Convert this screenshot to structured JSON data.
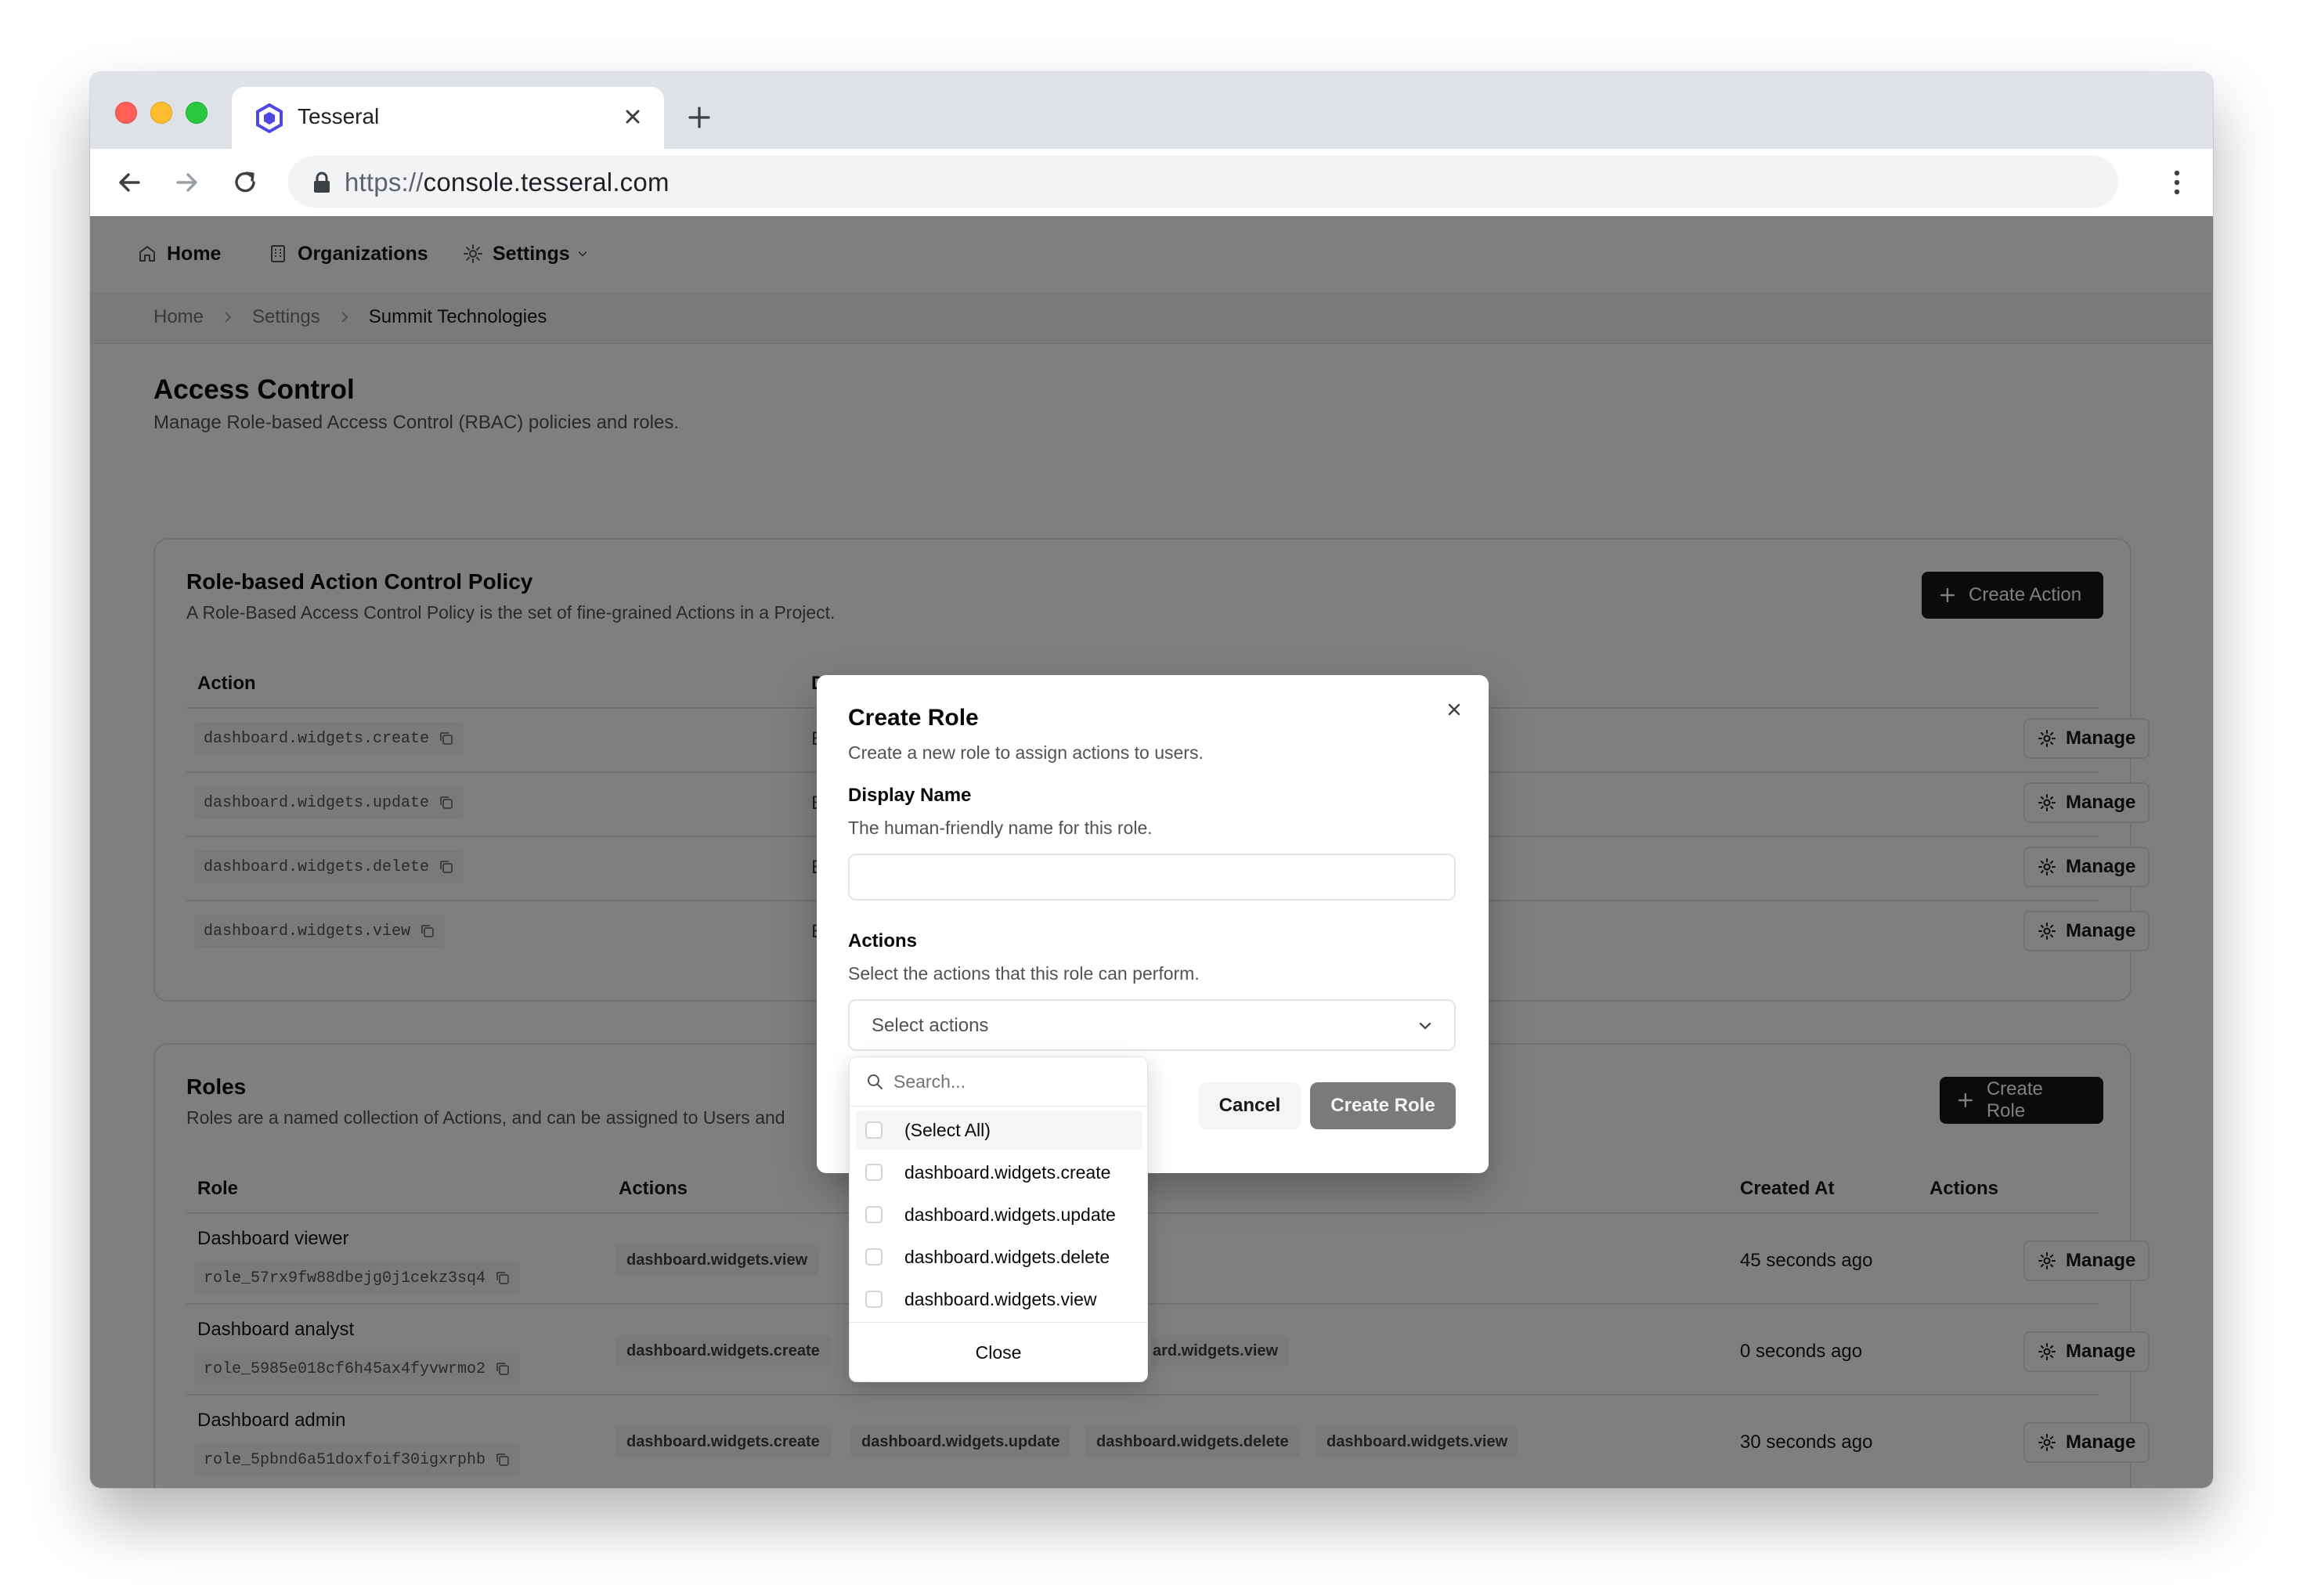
{
  "browser": {
    "tab_title": "Tesseral",
    "url_scheme": "https://",
    "url_host": "console.tesseral.com"
  },
  "nav": {
    "home": "Home",
    "organizations": "Organizations",
    "settings": "Settings"
  },
  "breadcrumb": [
    "Home",
    "Settings",
    "Summit Technologies"
  ],
  "page": {
    "title": "Access Control",
    "subtitle": "Manage Role-based Access Control (RBAC) policies and roles."
  },
  "policy": {
    "title": "Role-based Action Control Policy",
    "description": "A Role-Based Access Control Policy is the set of fine-grained Actions in a Project.",
    "create_label": "Create Action",
    "col_action": "Action",
    "col_partial": "D",
    "manage_label": "Manage",
    "actions": [
      {
        "name": "dashboard.widgets.create",
        "partial": "E"
      },
      {
        "name": "dashboard.widgets.update",
        "partial": "E"
      },
      {
        "name": "dashboard.widgets.delete",
        "partial": "E"
      },
      {
        "name": "dashboard.widgets.view",
        "partial": "E"
      }
    ]
  },
  "roles": {
    "title": "Roles",
    "description": "Roles are a named collection of Actions, and can be assigned to Users and",
    "create_label": "Create Role",
    "col_role": "Role",
    "col_actions": "Actions",
    "col_created": "Created At",
    "col_row_actions": "Actions",
    "manage_label": "Manage",
    "rows": [
      {
        "name": "Dashboard viewer",
        "id": "role_57rx9fw88dbejg0j1cekz3sq4",
        "actions": [
          "dashboard.widgets.view"
        ],
        "created": "45 seconds ago"
      },
      {
        "name": "Dashboard analyst",
        "id": "role_5985e018cf6h45ax4fyvwrmo2",
        "actions": [
          "dashboard.widgets.create",
          "ard.widgets.view"
        ],
        "created": "0 seconds ago"
      },
      {
        "name": "Dashboard admin",
        "id": "role_5pbnd6a51doxfoif30igxrphb",
        "actions": [
          "dashboard.widgets.create",
          "dashboard.widgets.update",
          "dashboard.widgets.delete",
          "dashboard.widgets.view"
        ],
        "created": "30 seconds ago"
      }
    ]
  },
  "dialog": {
    "title": "Create Role",
    "description": "Create a new role to assign actions to users.",
    "display_name_label": "Display Name",
    "display_name_help": "The human-friendly name for this role.",
    "display_name_value": "",
    "actions_label": "Actions",
    "actions_help": "Select the actions that this role can perform.",
    "select_placeholder": "Select actions",
    "cancel_label": "Cancel",
    "create_label": "Create Role"
  },
  "dropdown": {
    "search_placeholder": "Search...",
    "options": [
      "(Select All)",
      "dashboard.widgets.create",
      "dashboard.widgets.update",
      "dashboard.widgets.delete",
      "dashboard.widgets.view"
    ],
    "close_label": "Close"
  },
  "colors": {
    "primary_button": "#171717",
    "overlay": "rgba(0,0,0,0.5)",
    "disabled_button": "#7a7a7a"
  }
}
